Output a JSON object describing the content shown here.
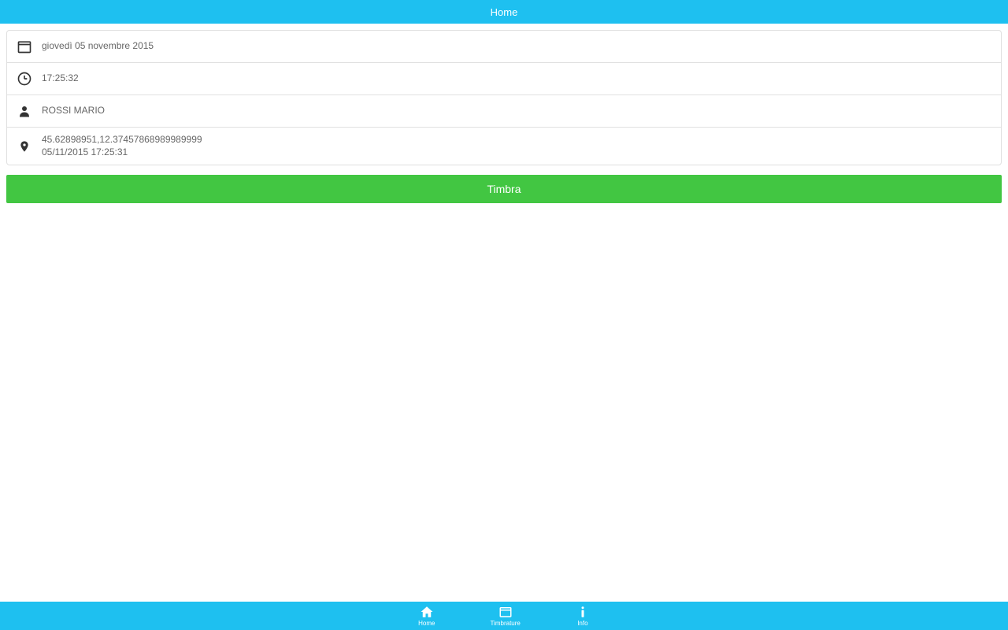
{
  "header": {
    "title": "Home"
  },
  "info": {
    "date": "giovedì 05 novembre 2015",
    "time": "17:25:32",
    "user": "ROSSI MARIO",
    "location_coords": "45.62898951,12.37457868989989999",
    "location_timestamp": "05/11/2015 17:25:31"
  },
  "actions": {
    "primary_label": "Timbra"
  },
  "nav": {
    "items": [
      {
        "label": "Home"
      },
      {
        "label": "Timbrature"
      },
      {
        "label": "Info"
      }
    ]
  }
}
